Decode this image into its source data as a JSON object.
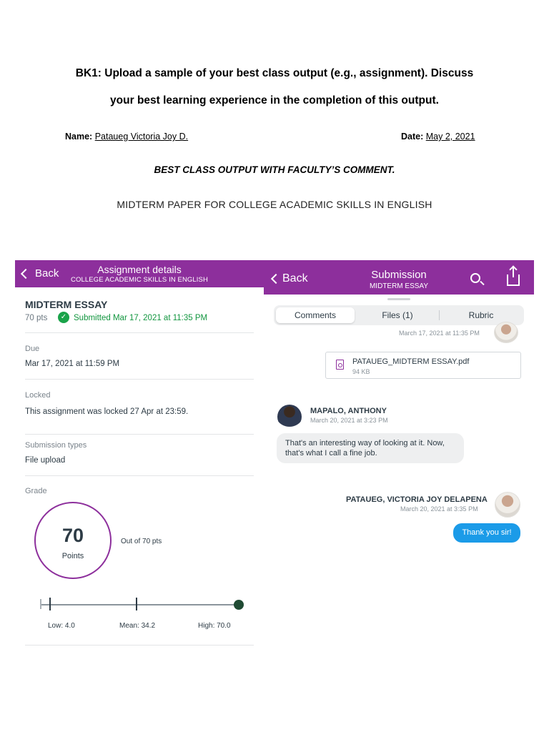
{
  "document": {
    "prompt_line1": "BK1: Upload a sample of your best class output (e.g., assignment). Discuss",
    "prompt_line2": "your best learning experience in the completion of this output.",
    "name_label": "Name:",
    "name_value": "Pataueg Victoria Joy D.",
    "date_label": "Date:",
    "date_value": "May 2, 2021",
    "best_output_heading": "BEST CLASS OUTPUT WITH FACULTY’S COMMENT.",
    "midterm_heading": "MIDTERM PAPER FOR COLLEGE ACADEMIC SKILLS IN ENGLISH"
  },
  "assignment_screen": {
    "back_label": "Back",
    "title": "Assignment details",
    "subtitle": "COLLEGE ACADEMIC SKILLS IN ENGLISH",
    "assignment_title": "MIDTERM ESSAY",
    "points": "70 pts",
    "submitted": "Submitted Mar 17, 2021 at 11:35 PM",
    "due_label": "Due",
    "due_value": "Mar 17, 2021 at 11:59 PM",
    "locked_label": "Locked",
    "locked_value": "This assignment was locked 27 Apr at 23:59.",
    "submission_types_label": "Submission types",
    "submission_types_value": "File upload",
    "grade_label": "Grade",
    "grade_value": "70",
    "grade_unit": "Points",
    "out_of": "Out of 70 pts",
    "low": "Low: 4.0",
    "mean": "Mean: 34.2",
    "high": "High: 70.0"
  },
  "submission_screen": {
    "back_label": "Back",
    "title": "Submission",
    "subtitle": "MIDTERM ESSAY",
    "icons": {
      "search": "search-icon",
      "share": "share-icon"
    },
    "tabs": [
      "Comments",
      "Files (1)",
      "Rubric"
    ],
    "first_timestamp": "March 17, 2021 at 11:35 PM",
    "file_name": "PATAUEG_MIDTERM ESSAY.pdf",
    "file_size": "94 KB",
    "teacher_name": "MAPALO, ANTHONY",
    "teacher_timestamp": "March 20, 2021 at 3:23 PM",
    "teacher_comment_line1": "That's an interesting way of looking at it. Now,",
    "teacher_comment_line2": "that's what I call a fine job.",
    "student_name": "PATAUEG, VICTORIA JOY DELAPENA",
    "student_timestamp": "March 20, 2021 at 3:35 PM",
    "student_reply": "Thank you sir!"
  },
  "colors": {
    "brand": "#8d2f9c",
    "success": "#12963f",
    "reply_bubble": "#1b9be8"
  }
}
